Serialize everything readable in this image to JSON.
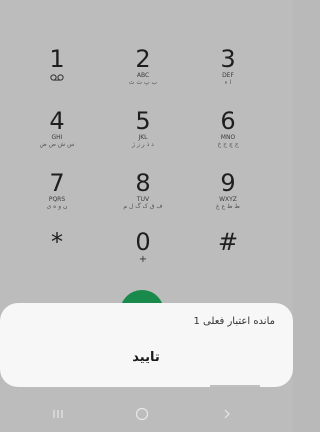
{
  "keypad": {
    "keys": [
      {
        "digit": "1",
        "sub": "",
        "sub2": "",
        "glyph": "voicemail-icon"
      },
      {
        "digit": "2",
        "sub": "ABC",
        "sub2": "ب پ ت ث"
      },
      {
        "digit": "3",
        "sub": "DEF",
        "sub2": "ا ء"
      },
      {
        "digit": "4",
        "sub": "GHI",
        "sub2": "س ش ص ض"
      },
      {
        "digit": "5",
        "sub": "JKL",
        "sub2": "د ذ ر ز ژ"
      },
      {
        "digit": "6",
        "sub": "MNO",
        "sub2": "ج چ ح خ"
      },
      {
        "digit": "7",
        "sub": "PQRS",
        "sub2": "ن و ه ی"
      },
      {
        "digit": "8",
        "sub": "TUV",
        "sub2": "ف ق ک گ ل م"
      },
      {
        "digit": "9",
        "sub": "WXYZ",
        "sub2": "ط ظ ع غ"
      },
      {
        "digit": "*",
        "sub": "",
        "sub2": ""
      },
      {
        "digit": "0",
        "sub": "+",
        "sub2": ""
      },
      {
        "digit": "#",
        "sub": "",
        "sub2": ""
      }
    ]
  },
  "call_button": {
    "color": "#1a8a4c",
    "icon": "phone-icon"
  },
  "dialog": {
    "message": "مانده اعتبار فعلی 1",
    "confirm_label": "تایید"
  },
  "navbar": {
    "recent_icon": "recent-apps-icon",
    "home_icon": "home-icon",
    "back_icon": "back-icon"
  }
}
